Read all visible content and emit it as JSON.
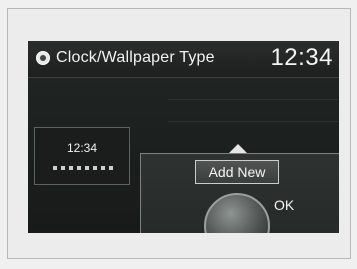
{
  "screen": {
    "title": "Clock/Wallpaper Type",
    "clock": "12:34",
    "home_icon": "home-icon"
  },
  "thumbnail": {
    "time": "12:34"
  },
  "popup": {
    "add_new_label": "Add New",
    "ok_label": "OK"
  }
}
